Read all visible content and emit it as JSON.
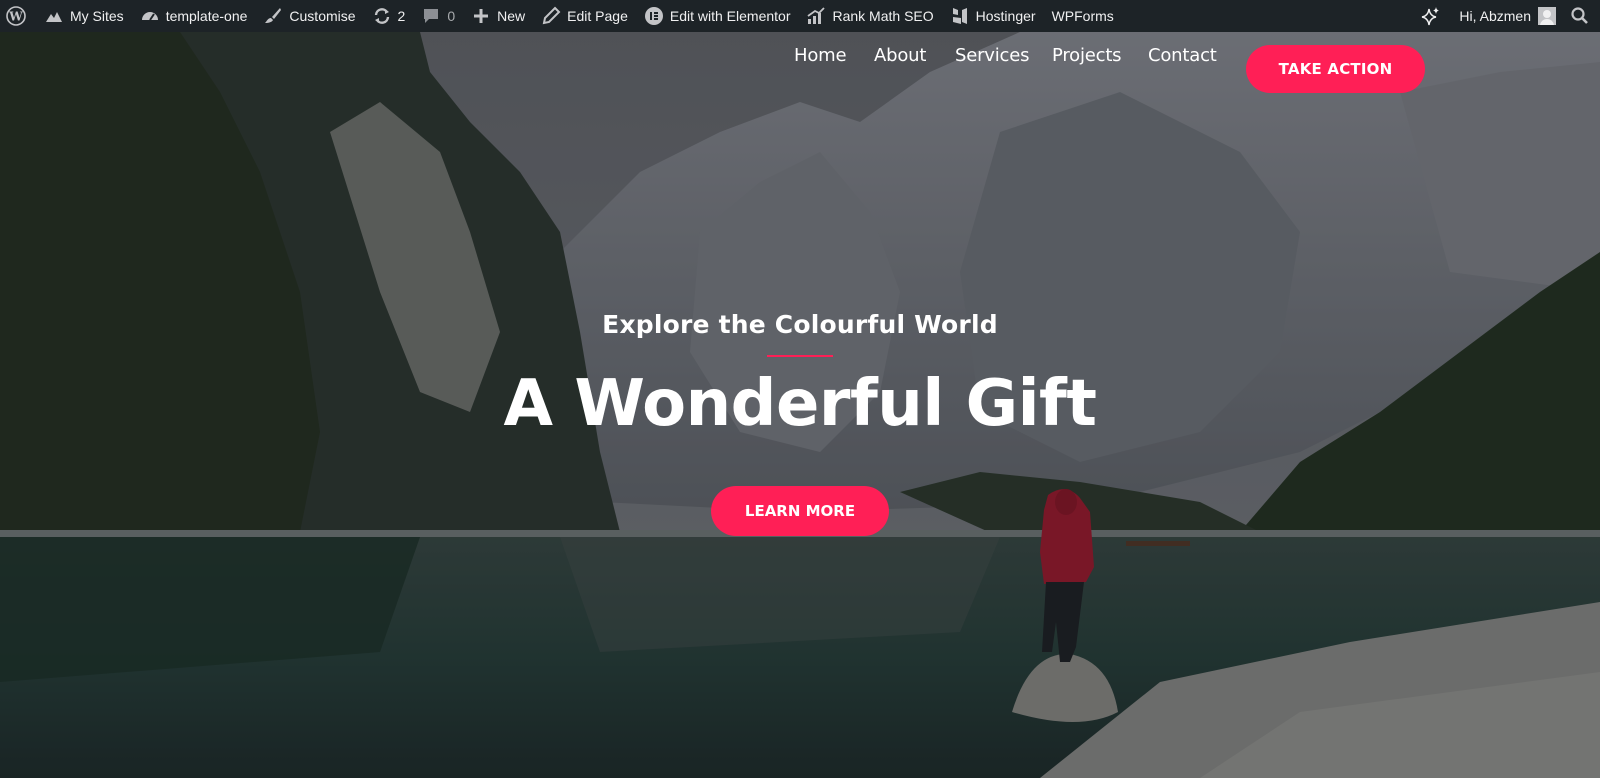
{
  "adminbar": {
    "items_left": [
      {
        "icon": "wordpress-icon",
        "label": ""
      },
      {
        "icon": "my-sites-icon",
        "label": "My Sites"
      },
      {
        "icon": "dashboard-icon",
        "label": "template-one"
      },
      {
        "icon": "brush-icon",
        "label": "Customise"
      },
      {
        "icon": "updates-icon",
        "label": "2"
      },
      {
        "icon": "comments-icon",
        "label": "0"
      },
      {
        "icon": "plus-icon",
        "label": "New"
      },
      {
        "icon": "pencil-icon",
        "label": "Edit Page"
      },
      {
        "icon": "elementor-icon",
        "label": "Edit with Elementor"
      },
      {
        "icon": "rank-math-icon",
        "label": "Rank Math SEO"
      },
      {
        "icon": "hostinger-icon",
        "label": "Hostinger"
      },
      {
        "icon": "",
        "label": "WPForms"
      }
    ],
    "greeting": "Hi, Abzmen",
    "ai_icon": "sparkle-icon",
    "search_icon": "search-icon"
  },
  "nav": {
    "links": [
      "Home",
      "About",
      "Services",
      "Projects",
      "Contact"
    ],
    "cta": "TAKE ACTION"
  },
  "hero": {
    "subtitle": "Explore the Colourful World",
    "title": "A Wonderful Gift",
    "button": "LEARN MORE"
  },
  "colors": {
    "adminbar_bg": "#1d2327",
    "accent": "#ff1f56",
    "text": "#ffffff"
  }
}
